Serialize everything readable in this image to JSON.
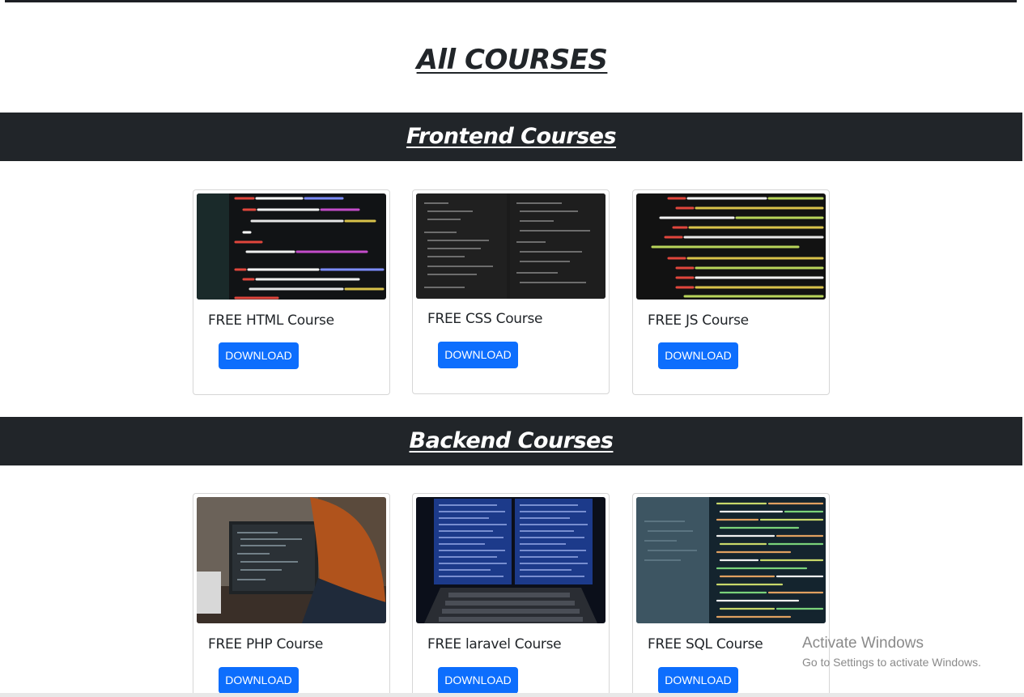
{
  "page_title": "All COURSES",
  "sections": {
    "frontend": {
      "heading": "Frontend Courses",
      "cards": [
        {
          "title": "FREE HTML Course",
          "button": "DOWNLOAD"
        },
        {
          "title": "FREE CSS Course",
          "button": "DOWNLOAD"
        },
        {
          "title": "FREE JS Course",
          "button": "DOWNLOAD"
        }
      ]
    },
    "backend": {
      "heading": "Backend Courses",
      "cards": [
        {
          "title": "FREE PHP Course",
          "button": "DOWNLOAD"
        },
        {
          "title": "FREE laravel Course",
          "button": "DOWNLOAD"
        },
        {
          "title": "FREE SQL Course",
          "button": "DOWNLOAD"
        }
      ]
    }
  },
  "watermark": {
    "line1": "Activate Windows",
    "line2": "Go to Settings to activate Windows."
  },
  "colors": {
    "section_bar": "#212529",
    "button": "#0d6efd"
  }
}
